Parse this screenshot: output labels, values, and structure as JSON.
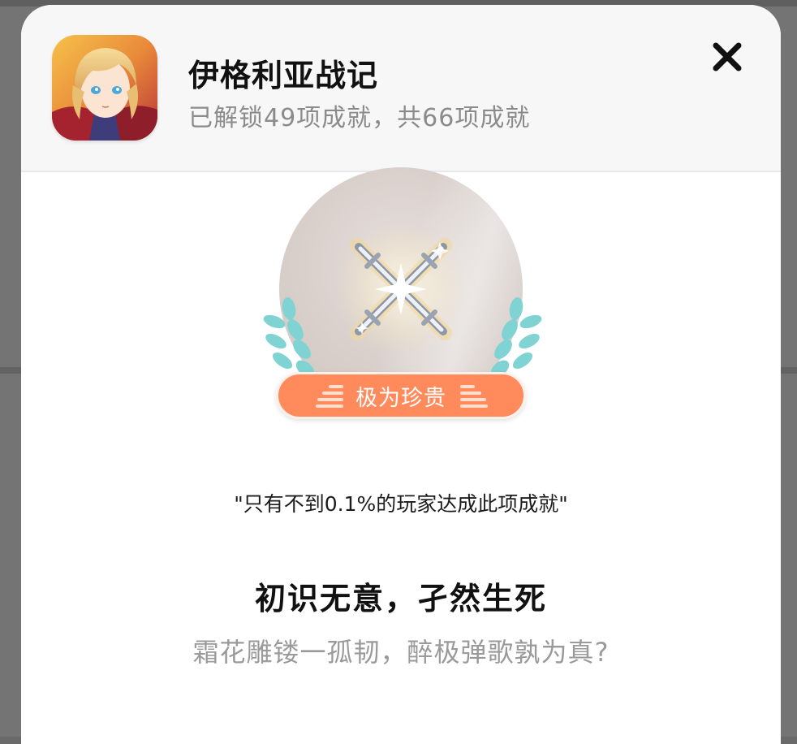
{
  "header": {
    "game_title": "伊格利亚战记",
    "achievement_summary": "已解锁49项成就，共66项成就",
    "close_icon": "close-icon"
  },
  "badge": {
    "icon": "crossed-swords-icon",
    "laurel_color": "#7fd3d3",
    "rarity_label": "极为珍贵",
    "rarity_color": "#ff8a5c"
  },
  "achievement": {
    "rarity_note": "\"只有不到0.1%的玩家达成此项成就\"",
    "name": "初识无意，孑然生死",
    "description": "霜花雕镂一孤韧，醉极弹歌孰为真?"
  }
}
